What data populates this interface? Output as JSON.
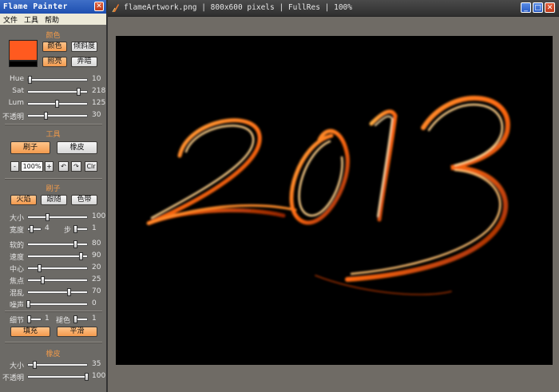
{
  "canvas_window": {
    "title": "flameArtwork.png | 800x600 pixels | FullRes | 100%",
    "min_icon": "minimize-icon",
    "max_icon": "maximize-icon",
    "close_icon": "close-icon"
  },
  "artwork": {
    "text": "2013"
  },
  "panel": {
    "title": "Flame Painter",
    "menu": [
      "文件",
      "工具",
      "帮助"
    ],
    "colors": {
      "header": "颜色",
      "swatch_color": "#ff5a1f",
      "buttons": [
        "颜色",
        "倾斜度",
        "照亮",
        "弄暗"
      ],
      "sliders": [
        {
          "label": "Hue",
          "value": "10",
          "level": 0.03
        },
        {
          "label": "Sat",
          "value": "218",
          "level": 0.86
        },
        {
          "label": "Lum",
          "value": "125",
          "level": 0.49
        },
        {
          "label": "不透明",
          "value": "30",
          "level": 0.3
        }
      ]
    },
    "tools": {
      "header": "工具",
      "brush_button": "刷子",
      "eraser_button": "橡皮",
      "zoom_minus": "-",
      "zoom_value": "100%",
      "zoom_plus": "+",
      "undo_icon": "undo-icon",
      "redo_icon": "redo-icon",
      "clear_label": "Clr"
    },
    "brush": {
      "header": "刷子",
      "modes": [
        "火焰",
        "跟随",
        "色带"
      ],
      "sliders": [
        {
          "label": "大小",
          "value": "100",
          "level": 0.33
        },
        {
          "label": "软的",
          "value": "80",
          "level": 0.8
        },
        {
          "label": "速度",
          "value": "90",
          "level": 0.9
        },
        {
          "label": "中心",
          "value": "20",
          "level": 0.2
        },
        {
          "label": "焦点",
          "value": "25",
          "level": 0.25
        },
        {
          "label": "混乱",
          "value": "70",
          "level": 0.7
        },
        {
          "label": "噪声",
          "value": "0",
          "level": 0.0
        }
      ],
      "width_label": "宽度",
      "width_value": "4",
      "step_label": "步",
      "step_value": "1",
      "detail_label": "细节",
      "detail_value": "1",
      "line_color_label": "褪色",
      "line_color_value": "1",
      "fill_button": "填充",
      "smooth_button": "平滑"
    },
    "eraser": {
      "header": "橡皮",
      "sliders": [
        {
          "label": "大小",
          "value": "35",
          "level": 0.12
        },
        {
          "label": "不透明",
          "value": "100",
          "level": 1.0
        }
      ]
    }
  }
}
